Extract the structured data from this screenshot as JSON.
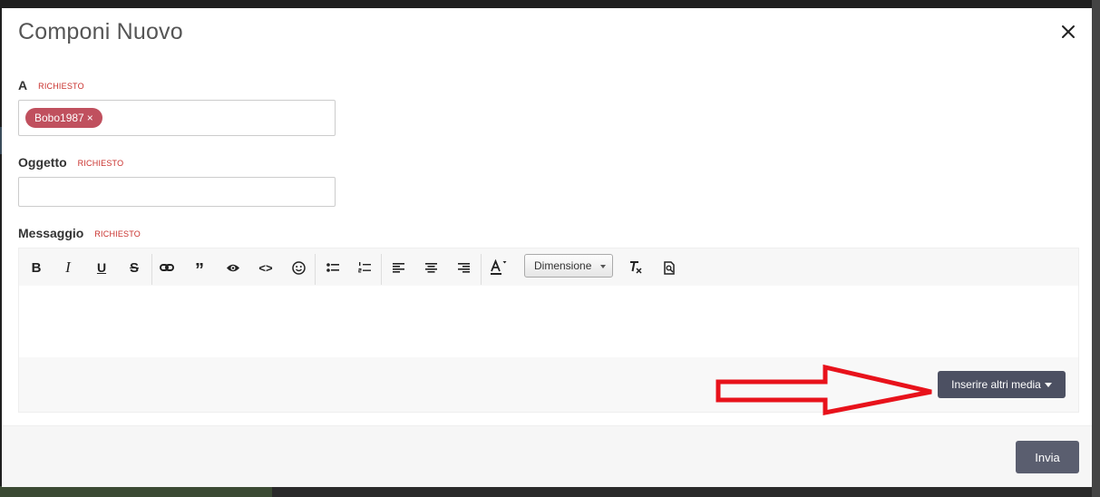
{
  "modal": {
    "title": "Componi Nuovo"
  },
  "form": {
    "to": {
      "label": "A",
      "required": "RICHIESTO",
      "tags": [
        {
          "name": "Bobo1987",
          "remove": "×"
        }
      ]
    },
    "subject": {
      "label": "Oggetto",
      "required": "RICHIESTO",
      "value": ""
    },
    "message": {
      "label": "Messaggio",
      "required": "RICHIESTO"
    }
  },
  "toolbar": {
    "icons": [
      "bold-icon",
      "italic-icon",
      "underline-icon",
      "strikethrough-icon",
      "link-icon",
      "quote-icon",
      "preview-eye-icon",
      "code-icon",
      "emoji-icon",
      "bullet-list-icon",
      "numbered-list-icon",
      "align-left-icon",
      "align-center-icon",
      "align-right-icon",
      "text-color-icon",
      "clear-format-icon",
      "find-icon"
    ],
    "size_select": "Dimensione"
  },
  "editor": {
    "media_button": "Inserire altri media"
  },
  "footer": {
    "send_button": "Invia"
  },
  "colors": {
    "tag": "#c0505e",
    "required": "#c9302c",
    "button": "#4c5062",
    "arrow": "#e8121b"
  }
}
